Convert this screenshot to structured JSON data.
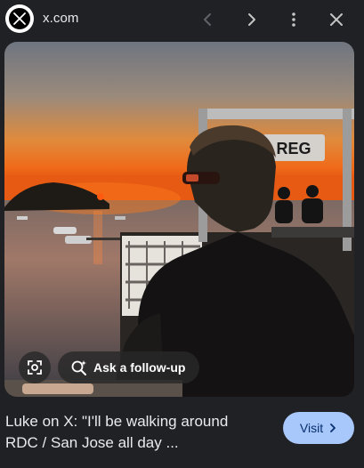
{
  "header": {
    "domain": "x.com",
    "logo_icon": "x-logo-icon",
    "prev_icon": "chevron-left-icon",
    "next_icon": "chevron-right-icon",
    "more_icon": "more-vert-icon",
    "close_icon": "close-icon"
  },
  "image": {
    "sign_text": "REG",
    "lens_icon": "lens-icon",
    "followup_icon": "search-spark-icon",
    "followup_label": "Ask a follow-up"
  },
  "result": {
    "title_line1": "Luke on X: \"I'll be walking around",
    "title_line2": "RDC / San Jose all day ...",
    "visit_label": "Visit"
  },
  "colors": {
    "background": "#202124",
    "accent_button": "#a8c7fa",
    "accent_text": "#062e6f"
  }
}
